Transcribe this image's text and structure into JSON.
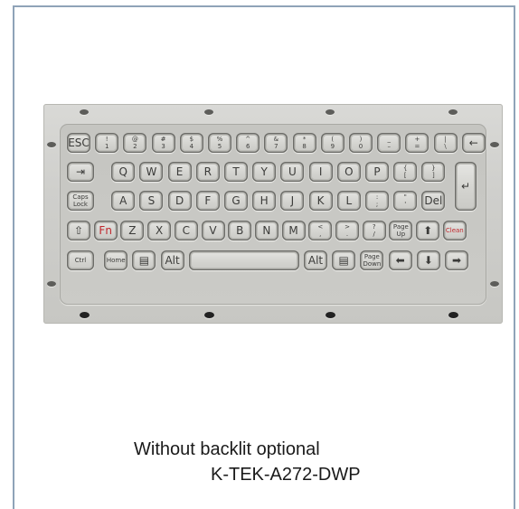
{
  "caption": {
    "line1": "Without backlit optional",
    "line2": "K-TEK-A272-DWP"
  },
  "keyboard": {
    "row1": [
      "ESC",
      "! 1",
      "@ 2",
      "# 3",
      "$ 4",
      "% 5",
      "^ 6",
      "& 7",
      "* 8",
      "( 9",
      ") 0",
      "_ –",
      "+ =",
      "| \\",
      "←"
    ],
    "row2": [
      "⇥",
      "Q",
      "W",
      "E",
      "R",
      "T",
      "Y",
      "U",
      "I",
      "O",
      "P",
      "{ [",
      "} ]"
    ],
    "row3": [
      "Caps Lock",
      "A",
      "S",
      "D",
      "F",
      "G",
      "H",
      "J",
      "K",
      "L",
      ": ;",
      "\" '",
      "Del"
    ],
    "row4": [
      "⇧",
      "Fn",
      "Z",
      "X",
      "C",
      "V",
      "B",
      "N",
      "M",
      "< ,",
      "> .",
      "? /",
      "Page Up",
      "⬆",
      "Clean"
    ],
    "row5": [
      "Ctrl",
      "Home",
      "▤",
      "Alt",
      "",
      "Alt",
      "▤",
      "Page Down",
      "⬅",
      "⬇",
      "➡"
    ],
    "enter": "↵"
  }
}
